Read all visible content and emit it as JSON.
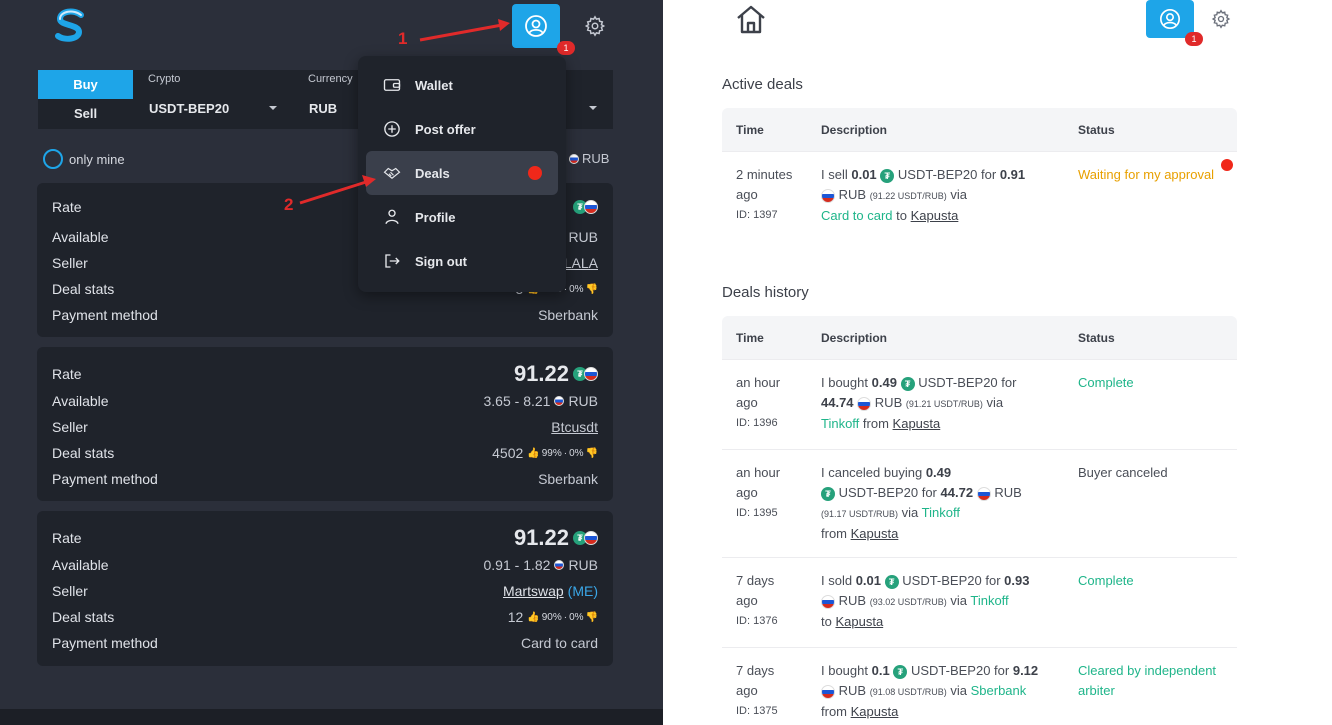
{
  "left": {
    "annotations": [
      "1",
      "2"
    ],
    "notification_count": "1",
    "buy_label": "Buy",
    "sell_label": "Sell",
    "crypto_label": "Crypto",
    "crypto_value": "USDT-BEP20",
    "currency_label": "Currency",
    "currency_value": "RUB",
    "only_mine": "only mine",
    "rub": "RUB",
    "menu": [
      {
        "label": "Wallet"
      },
      {
        "label": "Post offer"
      },
      {
        "label": "Deals"
      },
      {
        "label": "Profile"
      },
      {
        "label": "Sign out"
      }
    ],
    "offers": [
      {
        "rate_label": "Rate",
        "rate": "",
        "available_label": "Available",
        "available": "RUB",
        "seller_label": "Seller",
        "seller": "LALA",
        "seller_tag": "",
        "stats_label": "Deal stats",
        "stats_count": "5",
        "stats_up": "99%",
        "stats_down": "0%",
        "payment_label": "Payment method",
        "payment": "Sberbank"
      },
      {
        "rate_label": "Rate",
        "rate": "91.22",
        "available_label": "Available",
        "available": "3.65 - 8.21",
        "available_cur": "RUB",
        "seller_label": "Seller",
        "seller": "Btcusdt",
        "seller_tag": "",
        "stats_label": "Deal stats",
        "stats_count": "4502",
        "stats_up": "99%",
        "stats_down": "0%",
        "payment_label": "Payment method",
        "payment": "Sberbank"
      },
      {
        "rate_label": "Rate",
        "rate": "91.22",
        "available_label": "Available",
        "available": "0.91 - 1.82",
        "available_cur": "RUB",
        "seller_label": "Seller",
        "seller": "Martswap",
        "seller_tag": "(ME)",
        "stats_label": "Deal stats",
        "stats_count": "12",
        "stats_up": "90%",
        "stats_down": "0%",
        "payment_label": "Payment method",
        "payment": "Card to card"
      }
    ]
  },
  "right": {
    "notification_count": "1",
    "active_heading": "Active deals",
    "history_heading": "Deals history",
    "col_time": "Time",
    "col_desc": "Description",
    "col_status": "Status",
    "active": [
      {
        "time1": "2 minutes",
        "time2": "ago",
        "id": "ID: 1397",
        "d1": "I sell",
        "amt": "0.01",
        "coin": "USDT-BEP20 for",
        "total": "0.91",
        "cur": "RUB",
        "rate": "(91.22 USDT/RUB)",
        "via": "via",
        "method": "Card to card",
        "to": "to",
        "peer": "Kapusta",
        "status": "Waiting for my approval"
      }
    ],
    "history": [
      {
        "time1": "an hour",
        "time2": "ago",
        "id": "ID: 1396",
        "d1": "I bought",
        "amt": "0.49",
        "coin": "USDT-BEP20 for",
        "total": "44.74",
        "cur": "RUB",
        "rate": "(91.21 USDT/RUB)",
        "via": "via",
        "method": "Tinkoff",
        "to": "from",
        "peer": "Kapusta",
        "status": "Complete"
      },
      {
        "time1": "an hour",
        "time2": "ago",
        "id": "ID: 1395",
        "d1": "I canceled buying",
        "amt": "0.49",
        "coin": "USDT-BEP20 for",
        "total": "44.72",
        "cur": "RUB",
        "rate": "(91.17 USDT/RUB)",
        "via": "via",
        "method": "Tinkoff",
        "to": "from",
        "peer": "Kapusta",
        "status": "Buyer canceled"
      },
      {
        "time1": "7 days",
        "time2": "ago",
        "id": "ID: 1376",
        "d1": "I sold",
        "amt": "0.01",
        "coin": "USDT-BEP20 for",
        "total": "0.93",
        "cur": "RUB",
        "rate": "(93.02 USDT/RUB)",
        "via": "via",
        "method": "Tinkoff",
        "to": "to",
        "peer": "Kapusta",
        "status": "Complete"
      },
      {
        "time1": "7 days",
        "time2": "ago",
        "id": "ID: 1375",
        "d1": "I bought",
        "amt": "0.1",
        "coin": "USDT-BEP20 for",
        "total": "9.12",
        "cur": "RUB",
        "rate": "(91.08 USDT/RUB)",
        "via": "via",
        "method": "Sberbank",
        "to": "from",
        "peer": "Kapusta",
        "status": "Cleared by independent arbiter"
      }
    ]
  },
  "colors": {
    "accent": "#1ea5e8",
    "dark_bg": "#2b2f3a",
    "card_bg": "#1f232b",
    "green": "#1fb58a",
    "warning": "#e8a000",
    "alert": "#e02a2a"
  }
}
